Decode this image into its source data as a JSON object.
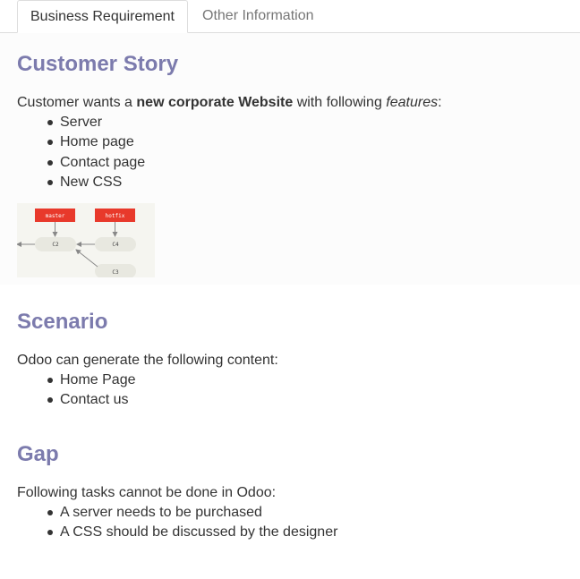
{
  "tabs": [
    {
      "label": "Business Requirement",
      "active": true
    },
    {
      "label": "Other Information",
      "active": false
    }
  ],
  "customer_story": {
    "heading": "Customer Story",
    "intro_prefix": "Customer wants a ",
    "intro_bold": "new corporate Website",
    "intro_mid": " with following ",
    "intro_italic": "features",
    "intro_suffix": ":",
    "items": [
      "Server",
      "Home page",
      "Contact page",
      "New CSS"
    ],
    "diagram": {
      "labels": {
        "master": "master",
        "hotfix": "hotfix"
      },
      "nodes": {
        "c2": "C2",
        "c4": "C4",
        "c3": "C3"
      }
    }
  },
  "scenario": {
    "heading": "Scenario",
    "intro": "Odoo can generate the following content:",
    "items": [
      "Home Page",
      "Contact us"
    ]
  },
  "gap": {
    "heading": "Gap",
    "intro": "Following tasks cannot be done in Odoo:",
    "items": [
      "A server needs to be purchased",
      "A CSS should be discussed by the designer"
    ]
  },
  "colors": {
    "heading": "#7c7bad",
    "branch_label": "#e8392b",
    "node_fill": "#e8e8e0"
  }
}
